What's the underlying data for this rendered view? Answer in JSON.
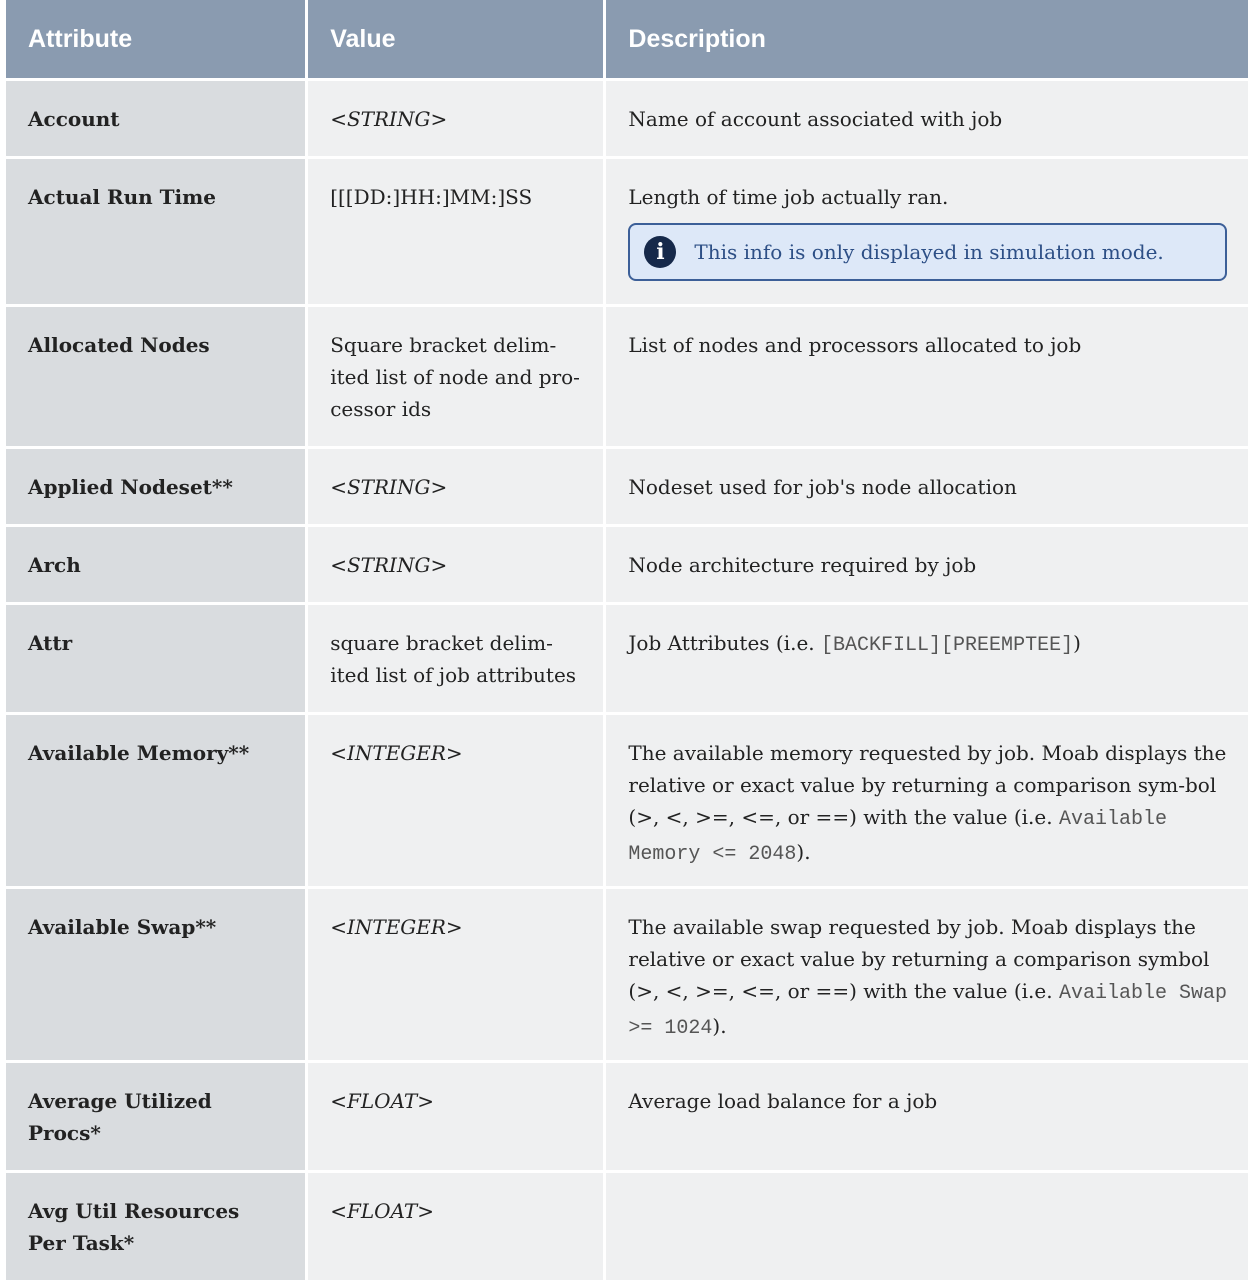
{
  "headers": [
    "Attribute",
    "Value",
    "Description"
  ],
  "icons": {
    "info": "info-icon"
  },
  "colors": {
    "header_bg": "#8a9bb0",
    "attr_bg": "#d9dcdf",
    "cell_bg": "#eff0f1",
    "note_border": "#3c5f98",
    "note_bg": "#dde8f8"
  },
  "rows": [
    {
      "attribute": "Account",
      "value": "<STRING>",
      "description": "Name of account associated with job"
    },
    {
      "attribute": "Actual Run Time",
      "value": "[[[DD:]HH:]MM:]SS",
      "description": "Length of time job actually ran.",
      "note": "This info is only displayed in simulation mode."
    },
    {
      "attribute": "Allocated Nodes",
      "value": "Square bracket delim-ited list of node and pro-cessor ids",
      "value_lines": [
        "Square bracket delim-",
        "ited list of node and pro-",
        "cessor ids"
      ],
      "description": "List of nodes and processors allocated to job"
    },
    {
      "attribute": "Applied Nodeset**",
      "value": "<STRING>",
      "description": "Nodeset used for job's node allocation"
    },
    {
      "attribute": "Arch",
      "value": "<STRING>",
      "description": "Node architecture required by job"
    },
    {
      "attribute": "Attr",
      "value": "square bracket delim-ited list of job attributes",
      "value_lines": [
        "square bracket delim-",
        "ited list of job attributes"
      ],
      "description_text": "Job Attributes (i.e. ",
      "description_code": "[BACKFILL][PREEMPTEE]",
      "description_tail": ")"
    },
    {
      "attribute": "Available Memory**",
      "value": "<INTEGER>",
      "description_text": "The available memory requested by job. Moab displays the relative or exact value by returning a comparison sym-bol (>, <, >=, <=, or ==) with the value (i.e. ",
      "description_code": "Available Memory <= 2048",
      "description_tail": ")."
    },
    {
      "attribute": "Available Swap**",
      "value": "<INTEGER>",
      "description_text": "The available swap requested by job. Moab displays the relative or exact value by returning a comparison symbol (>, <, >=, <=, or ==) with the value (i.e. ",
      "description_code": "Available Swap >= 1024",
      "description_tail": ")."
    },
    {
      "attribute": "Average Utilized Procs*",
      "value": "<FLOAT>",
      "description": "Average load balance for a job"
    },
    {
      "attribute": "Avg Util Resources Per Task*",
      "value": "<FLOAT>",
      "description": ""
    }
  ]
}
